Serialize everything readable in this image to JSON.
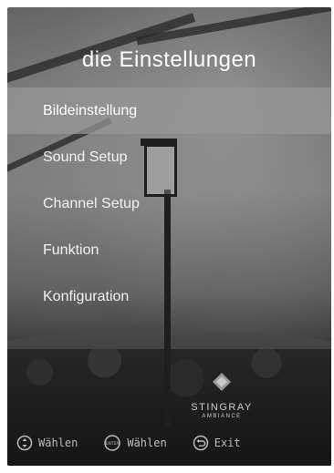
{
  "header": {
    "title": "die Einstellungen"
  },
  "menu": {
    "items": [
      {
        "label": "Bildeinstellung",
        "selected": true
      },
      {
        "label": "Sound Setup",
        "selected": false
      },
      {
        "label": "Channel Setup",
        "selected": false
      },
      {
        "label": "Funktion",
        "selected": false
      },
      {
        "label": "Konfiguration",
        "selected": false
      }
    ]
  },
  "branding": {
    "name": "STINGRAY",
    "subtitle": "AMBIANCE"
  },
  "footer": {
    "hints": [
      {
        "icon": "updown-icon",
        "label": "Wählen"
      },
      {
        "icon": "enter-icon",
        "icon_text": "ENTER",
        "label": "Wählen"
      },
      {
        "icon": "back-icon",
        "label": "Exit"
      }
    ]
  }
}
